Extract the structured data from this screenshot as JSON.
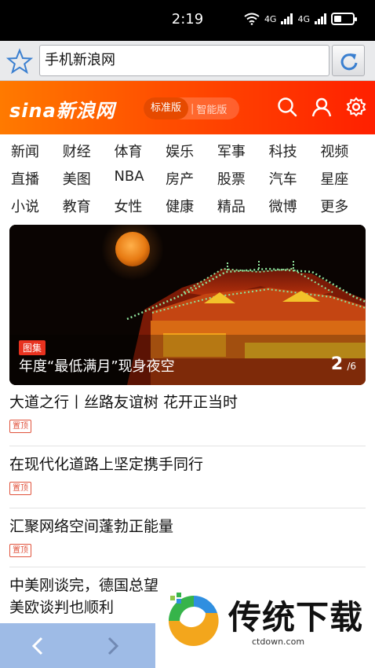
{
  "status": {
    "time": "2:19",
    "net1": "4G",
    "net2": "4G"
  },
  "browser": {
    "url_value": "手机新浪网"
  },
  "header": {
    "logo": "sina新浪网",
    "edition_standard": "标准版",
    "edition_sep": "|",
    "edition_smart": "智能版"
  },
  "nav": {
    "rows": [
      [
        "新闻",
        "财经",
        "体育",
        "娱乐",
        "军事",
        "科技",
        "视频"
      ],
      [
        "直播",
        "美图",
        "NBA",
        "房产",
        "股票",
        "汽车",
        "星座"
      ],
      [
        "小说",
        "教育",
        "女性",
        "健康",
        "精品",
        "微博",
        "更多"
      ]
    ]
  },
  "hero": {
    "tag": "图集",
    "caption": "年度“最低满月”现身夜空",
    "current": "2",
    "total": "/6"
  },
  "news": [
    {
      "title": "大道之行丨丝路友谊树 花开正当时",
      "badge": "置顶"
    },
    {
      "title": "在现代化道路上坚定携手同行",
      "badge": "置顶"
    },
    {
      "title": "汇聚网络空间蓬勃正能量",
      "badge": "置顶"
    },
    {
      "title": "中美刚谈完，德国总望美欧谈判也顺利",
      "badge": ""
    }
  ],
  "ad": {
    "brand": "传统下载",
    "domain": "ctdown.com"
  },
  "colors": {
    "header_start": "#ff7a00",
    "header_end": "#ff2000",
    "badge": "#e0533d",
    "bottombar": "#9ebbe6"
  }
}
